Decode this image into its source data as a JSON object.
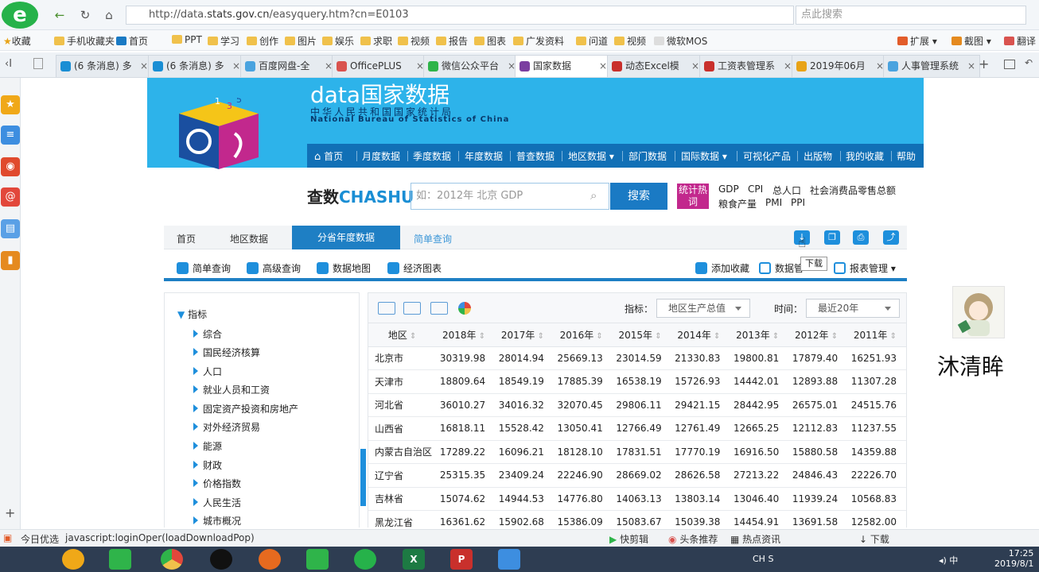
{
  "browser": {
    "url_prefix": "http://data.",
    "url_domain": "stats.gov.cn",
    "url_suffix": "/easyquery.htm?cn=E0103",
    "search_placeholder": "点此搜索",
    "bookmarks": [
      "收藏",
      "手机收藏夹",
      "首页",
      "PPT",
      "学习",
      "创作",
      "图片",
      "娱乐",
      "求职",
      "视频",
      "报告",
      "图表",
      "广发资料",
      "问道",
      "视频",
      "微软MOS"
    ],
    "bookmark_right": [
      "扩展",
      "截图",
      "翻译"
    ],
    "tabs": [
      "(6 条消息) 多",
      "(6 条消息) 多",
      "百度网盘-全",
      "OfficePLUS",
      "微信公众平台",
      "国家数据",
      "动态Excel模",
      "工资表管理系",
      "2019年06月",
      "人事管理系统"
    ],
    "active_tab": 5
  },
  "site": {
    "title": "data国家数据",
    "subtitle": "中华人民共和国国家统计局",
    "subtitle_en": "National Bureau of Statistics of China",
    "nav": [
      "首页",
      "月度数据",
      "季度数据",
      "年度数据",
      "普查数据",
      "地区数据",
      "部门数据",
      "国际数据",
      "可视化产品",
      "出版物",
      "我的收藏",
      "帮助"
    ],
    "chashu_a": "查数",
    "chashu_b": "CHASHU",
    "search_placeholder": "如：2012年 北京 GDP",
    "search_button": "搜索",
    "hot_label": "统计热词",
    "hot_row1": [
      "GDP",
      "CPI",
      "总人口",
      "社会消费品零售总额"
    ],
    "hot_row2": [
      "粮食产量",
      "PMI",
      "PPI"
    ]
  },
  "breadcrumb": {
    "items": [
      "首页",
      "地区数据",
      "分省年度数据",
      "简单查询"
    ]
  },
  "toolbar": {
    "left": [
      "简单查询",
      "高级查询",
      "数据地图",
      "经济图表"
    ],
    "add_fav": "添加收藏",
    "data_mgmt": "数据管",
    "report_mgmt": "报表管理",
    "tooltip": "下载"
  },
  "tree": {
    "root": "指标",
    "items": [
      "综合",
      "国民经济核算",
      "人口",
      "就业人员和工资",
      "固定资产投资和房地产",
      "对外经济贸易",
      "能源",
      "财政",
      "价格指数",
      "人民生活",
      "城市概况"
    ]
  },
  "filters": {
    "indicator_label": "指标：",
    "indicator_value": "地区生产总值",
    "time_label": "时间：",
    "time_value": "最近20年"
  },
  "table": {
    "headers": [
      "地区",
      "2018年",
      "2017年",
      "2016年",
      "2015年",
      "2014年",
      "2013年",
      "2012年",
      "2011年"
    ],
    "rows": [
      [
        "北京市",
        "30319.98",
        "28014.94",
        "25669.13",
        "23014.59",
        "21330.83",
        "19800.81",
        "17879.40",
        "16251.93"
      ],
      [
        "天津市",
        "18809.64",
        "18549.19",
        "17885.39",
        "16538.19",
        "15726.93",
        "14442.01",
        "12893.88",
        "11307.28"
      ],
      [
        "河北省",
        "36010.27",
        "34016.32",
        "32070.45",
        "29806.11",
        "29421.15",
        "28442.95",
        "26575.01",
        "24515.76"
      ],
      [
        "山西省",
        "16818.11",
        "15528.42",
        "13050.41",
        "12766.49",
        "12761.49",
        "12665.25",
        "12112.83",
        "11237.55"
      ],
      [
        "内蒙古自治区",
        "17289.22",
        "16096.21",
        "18128.10",
        "17831.51",
        "17770.19",
        "16916.50",
        "15880.58",
        "14359.88"
      ],
      [
        "辽宁省",
        "25315.35",
        "23409.24",
        "22246.90",
        "28669.02",
        "28626.58",
        "27213.22",
        "24846.43",
        "22226.70"
      ],
      [
        "吉林省",
        "15074.62",
        "14944.53",
        "14776.80",
        "14063.13",
        "13803.14",
        "13046.40",
        "11939.24",
        "10568.83"
      ],
      [
        "黑龙江省",
        "16361.62",
        "15902.68",
        "15386.09",
        "15083.67",
        "15039.38",
        "14454.91",
        "13691.58",
        "12582.00"
      ]
    ]
  },
  "author": {
    "name": "沐清眸"
  },
  "statusbar": {
    "left1": "今日优选",
    "left2": "javascript:loginOper(loadDownloadPop)",
    "right": [
      "快剪辑",
      "头条推荐",
      "热点资讯",
      "下载"
    ]
  },
  "clock": {
    "time": "17:25",
    "date": "2019/8/1"
  }
}
